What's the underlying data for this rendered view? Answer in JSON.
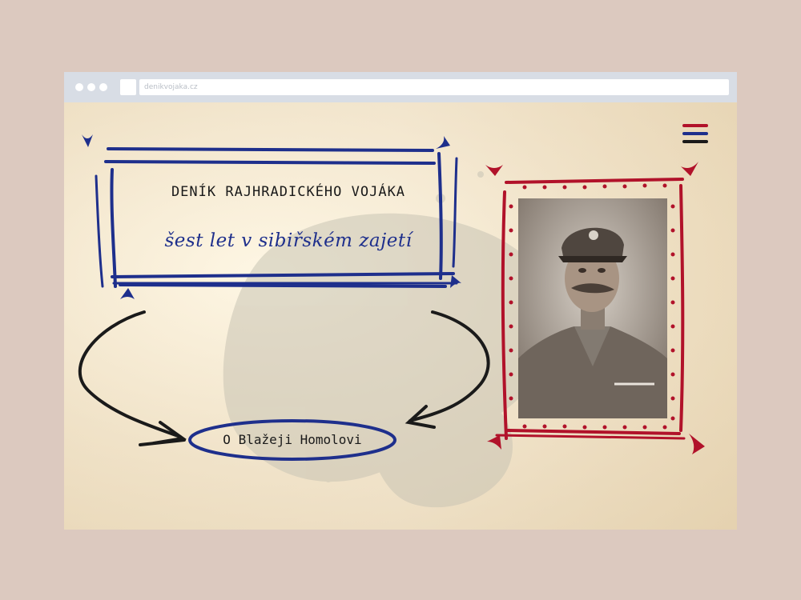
{
  "browser": {
    "url": "denikvojaka.cz"
  },
  "header": {
    "title": "DENÍK RAJHRADICKÉHO VOJÁKA",
    "subtitle": "šest let v sibiřském zajetí"
  },
  "nav": {
    "about_link": "O Blažeji Homolovi"
  },
  "colors": {
    "blue": "#1e2f8c",
    "red": "#b1122a",
    "ink": "#1a1a1a",
    "paper": "#f1e7d3"
  },
  "icons": {
    "menu": "hamburger-menu-icon",
    "photo": "soldier-portrait-photo"
  }
}
